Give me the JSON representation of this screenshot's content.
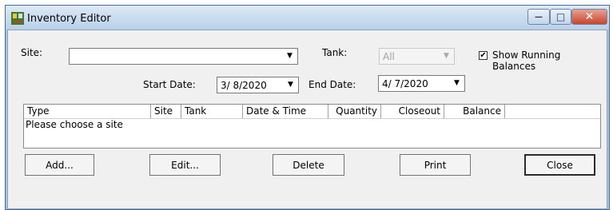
{
  "window": {
    "title": "Inventory Editor",
    "controls": {
      "minimize": "—",
      "maximize": "□",
      "close": "✕"
    }
  },
  "filters": {
    "site_label": "Site:",
    "site_value": "",
    "tank_label": "Tank:",
    "tank_value": "All",
    "show_running_balances_label": "Show Running Balances",
    "show_running_balances_checked": true,
    "start_date_label": "Start Date:",
    "start_date_value": "3/ 8/2020",
    "end_date_label": "End Date:",
    "end_date_value": "4/ 7/2020"
  },
  "list": {
    "columns": [
      "Type",
      "Site",
      "Tank",
      "Date & Time",
      "Quantity",
      "Closeout",
      "Balance"
    ],
    "rows": [
      "Please choose a site"
    ]
  },
  "buttons": {
    "add": "Add...",
    "edit": "Edit...",
    "delete": "Delete",
    "print": "Print",
    "close": "Close"
  }
}
